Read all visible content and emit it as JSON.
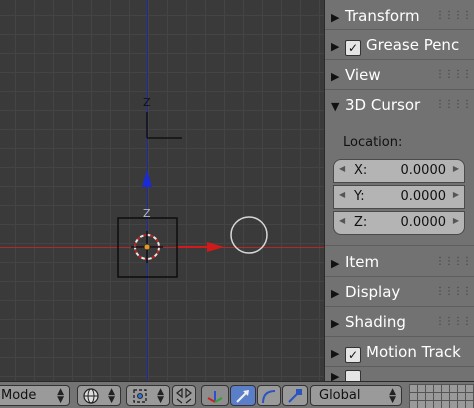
{
  "viewport": {
    "axis_label": "Z",
    "colors": {
      "x_axis": "#b3262a",
      "y_axis": "#1a2aa8"
    }
  },
  "sidebar": {
    "panels": [
      {
        "id": "transform",
        "label": "Transform",
        "expanded": false,
        "has_checkbox": false
      },
      {
        "id": "grease-pencil",
        "label": "Grease Penc",
        "expanded": false,
        "has_checkbox": true
      },
      {
        "id": "view",
        "label": "View",
        "expanded": false,
        "has_checkbox": false
      },
      {
        "id": "3d-cursor",
        "label": "3D Cursor",
        "expanded": true,
        "has_checkbox": false
      },
      {
        "id": "item",
        "label": "Item",
        "expanded": false,
        "has_checkbox": false
      },
      {
        "id": "display",
        "label": "Display",
        "expanded": false,
        "has_checkbox": false
      },
      {
        "id": "shading",
        "label": "Shading",
        "expanded": false,
        "has_checkbox": false
      },
      {
        "id": "motion-tracking",
        "label": "Motion Track",
        "expanded": false,
        "has_checkbox": true
      }
    ],
    "cursor": {
      "location_label": "Location:",
      "fields": [
        {
          "label": "X:",
          "value": "0.0000"
        },
        {
          "label": "Y:",
          "value": "0.0000"
        },
        {
          "label": "Z:",
          "value": "0.0000"
        }
      ]
    }
  },
  "header": {
    "mode_label": "Mode",
    "orientation_label": "Global"
  }
}
